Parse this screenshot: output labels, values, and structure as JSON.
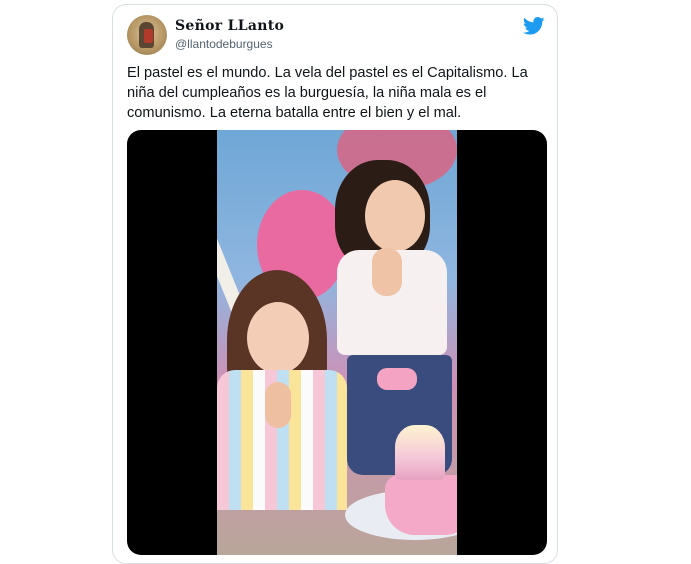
{
  "tweet": {
    "display_name": "Señor LLanto",
    "handle": "@llantodeburgues",
    "text": "El pastel es el mundo. La vela del pastel es el Capitalismo. La niña del cumpleaños es la burguesía, la niña mala es el comunismo. La eterna batalla entre el bien y el mal."
  },
  "icons": {
    "platform": "twitter-bird-icon"
  },
  "colors": {
    "brand": "#1d9bf0",
    "text": "#0f1419",
    "muted": "#536471"
  }
}
